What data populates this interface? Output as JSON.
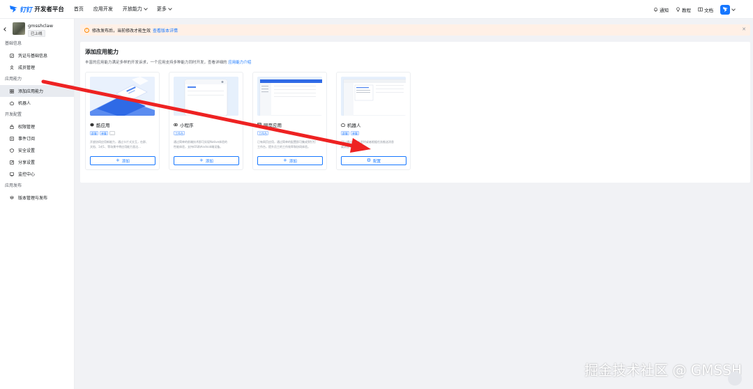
{
  "header": {
    "logo_word": "钉钉",
    "platform_title": "开发者平台",
    "nav": [
      {
        "label": "首页",
        "dropdown": false
      },
      {
        "label": "应用开发",
        "dropdown": false
      },
      {
        "label": "开放能力",
        "dropdown": true
      },
      {
        "label": "更多",
        "dropdown": true
      }
    ],
    "right": {
      "notifications": "通知",
      "tutorial": "教程",
      "docs": "文档"
    }
  },
  "sidebar": {
    "app_name": "gmsshclaw",
    "app_status": "已上线",
    "groups": [
      {
        "title": "基础信息",
        "items": [
          {
            "label": "凭证与基础信息",
            "icon": "credential-icon"
          },
          {
            "label": "成员管理",
            "icon": "user-icon"
          }
        ]
      },
      {
        "title": "应用能力",
        "items": [
          {
            "label": "添加应用能力",
            "icon": "grid-icon",
            "active": true
          },
          {
            "label": "机器人",
            "icon": "robot-icon"
          }
        ]
      },
      {
        "title": "开发配置",
        "items": [
          {
            "label": "权限管理",
            "icon": "lock-icon"
          },
          {
            "label": "事件订阅",
            "icon": "event-icon"
          },
          {
            "label": "安全设置",
            "icon": "shield-icon"
          },
          {
            "label": "分享设置",
            "icon": "share-icon"
          },
          {
            "label": "监控中心",
            "icon": "monitor-icon"
          }
        ]
      },
      {
        "title": "应用发布",
        "items": [
          {
            "label": "版本管理与发布",
            "icon": "version-icon"
          }
        ]
      }
    ]
  },
  "notice": {
    "text": "修改发布后，当前修改才能生效",
    "link": "查看版本详情"
  },
  "main": {
    "title": "添加应用能力",
    "desc": "丰富的应用能力满足多样的开发诉求，一个应用支持多种能力同时开发，查看详细的",
    "desc_link": "应用能力介绍",
    "cards": [
      {
        "title": "酷应用",
        "icon": "cube-icon",
        "tags": [
          "群聊",
          "单聊",
          "..."
        ],
        "desc_line1": "开放协同应用新能力，通过卡片式交互，在群、",
        "desc_line2": "文档、1对1、等场景中将应用能力直达...",
        "button": "添加"
      },
      {
        "title": "小程序",
        "icon": "link-icon",
        "tags": [
          "工作台"
        ],
        "desc_line1": "通过简单的前端技术即可实现Native体验的",
        "desc_line2": "性能体验，支持iOS和Android端设备。",
        "button": "添加"
      },
      {
        "title": "网页应用",
        "icon": "browser-icon",
        "tags": [
          "工作台"
        ],
        "desc_line1": "已有网页应用，通过简单的配置即可集成到钉钉",
        "desc_line2": "工作台，提升员工的工作效率和协同体验。",
        "button": "添加"
      },
      {
        "title": "机器人",
        "icon": "robot-icon",
        "tags": [
          "群聊",
          "单聊"
        ],
        "desc_line1": "可以通过机器人定时或者根据任务推送消息",
        "desc_line2": "或消息卡片，提高...",
        "button": "配置"
      }
    ]
  },
  "watermark": "掘金技术社区 @ GMSSH",
  "colors": {
    "brand": "#1677ff",
    "notice_bg": "#fff0e6",
    "arrow": "#ee2222"
  }
}
